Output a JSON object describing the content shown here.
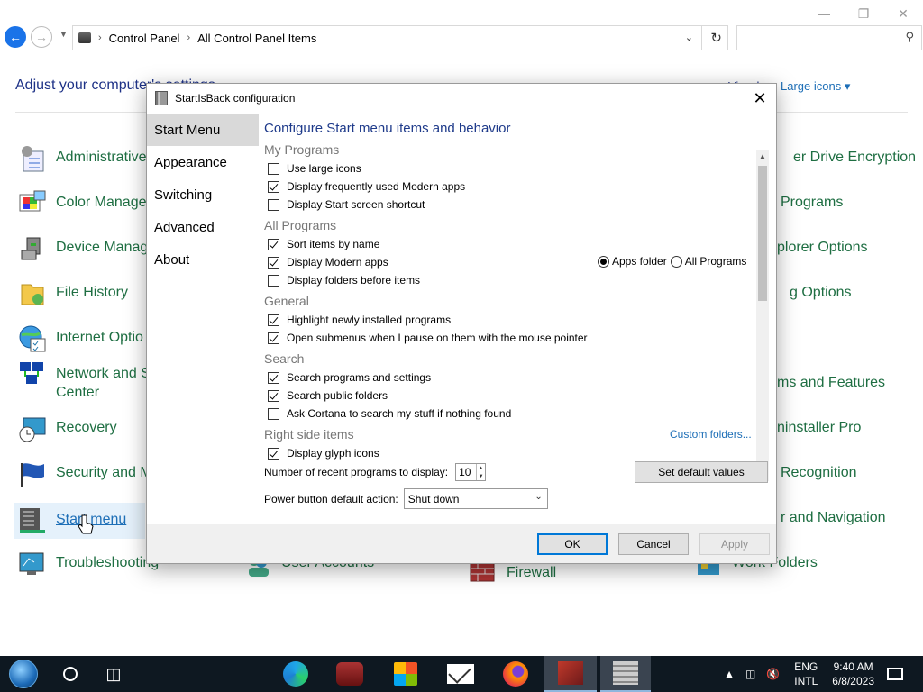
{
  "explorer": {
    "window_controls": [
      "—",
      "❐",
      "✕"
    ],
    "breadcrumb": [
      "Control Panel",
      "All Control Panel Items"
    ],
    "title": "Adjust your computer's settings",
    "view_by_label": "View by:",
    "view_by_value": "Large icons",
    "items": [
      {
        "label": "Administrative Tools",
        "icon": "admin-tools-icon"
      },
      {
        "label": "Color Management",
        "icon": "color-management-icon"
      },
      {
        "label": "Device Manager",
        "icon": "device-manager-icon"
      },
      {
        "label": "File History",
        "icon": "file-history-icon"
      },
      {
        "label": "Internet Options",
        "icon": "internet-options-icon"
      },
      {
        "label": "Network and Sharing Center",
        "icon": "network-icon"
      },
      {
        "label": "Recovery",
        "icon": "recovery-icon"
      },
      {
        "label": "Security and Maintenance",
        "icon": "security-flag-icon"
      },
      {
        "label": "Start menu",
        "icon": "start-menu-icon"
      },
      {
        "label": "Troubleshooting",
        "icon": "troubleshooting-icon"
      },
      {
        "label": "User Accounts",
        "icon": "user-accounts-icon"
      },
      {
        "label": "Windows Defender Firewall",
        "icon": "firewall-icon"
      },
      {
        "label": "Work Folders",
        "icon": "work-folders-icon"
      },
      {
        "label": "BitLocker Drive Encryption",
        "icon": "bitlocker-icon"
      },
      {
        "label": "Default Programs",
        "icon": "default-programs-icon"
      },
      {
        "label": "File Explorer Options",
        "icon": "explorer-options-icon"
      },
      {
        "label": "Indexing Options",
        "icon": "indexing-icon"
      },
      {
        "label": "Programs and Features",
        "icon": "programs-features-icon"
      },
      {
        "label": "Revo Uninstaller Pro",
        "icon": "revo-icon"
      },
      {
        "label": "Speech Recognition",
        "icon": "speech-icon"
      },
      {
        "label": "Taskbar and Navigation",
        "icon": "taskbar-nav-icon"
      }
    ],
    "visible_labels": {
      "admin": "Administrative",
      "color": "Color Manage",
      "device": "Device Manag",
      "filehistory": "File History",
      "internet": "Internet Optio",
      "network_1": "Network and S",
      "network_2": "Center",
      "recovery": "Recovery",
      "security": "Security and M",
      "startmenu": "Start menu",
      "trouble": "Troubleshooting",
      "users": "User Accounts",
      "firewall": "Firewall",
      "work": "Work Folders",
      "bitlocker": "er Drive Encryption",
      "defprog": "Programs",
      "feoptions": "plorer Options",
      "indexing": "g Options",
      "progfeat": "ms and Features",
      "revo": "ninstaller Pro",
      "speech": "Recognition",
      "taskbar": "r and Navigation"
    }
  },
  "dialog": {
    "title": "StartIsBack configuration",
    "nav": [
      "Start Menu",
      "Appearance",
      "Switching",
      "Advanced",
      "About"
    ],
    "active_nav": "Start Menu",
    "heading": "Configure Start menu items and behavior",
    "sections": {
      "my_programs": "My Programs",
      "all_programs": "All Programs",
      "general": "General",
      "search": "Search",
      "right_side": "Right side items"
    },
    "options": {
      "large_icons": {
        "label": "Use large icons",
        "checked": false
      },
      "freq_modern": {
        "label": "Display frequently used Modern apps",
        "checked": true
      },
      "start_screen": {
        "label": "Display Start screen shortcut",
        "checked": false
      },
      "sort_name": {
        "label": "Sort items by name",
        "checked": true
      },
      "modern_apps": {
        "label": "Display Modern apps",
        "checked": true
      },
      "folders_before": {
        "label": "Display folders before items",
        "checked": false
      },
      "highlight_new": {
        "label": "Highlight newly installed programs",
        "checked": true
      },
      "open_submenus": {
        "label": "Open submenus when I pause on them with the mouse pointer",
        "checked": true
      },
      "search_programs": {
        "label": "Search programs and settings",
        "checked": true
      },
      "search_public": {
        "label": "Search public folders",
        "checked": true
      },
      "ask_cortana": {
        "label": "Ask Cortana to search my stuff if nothing found",
        "checked": false
      },
      "glyph_icons": {
        "label": "Display glyph icons",
        "checked": true
      }
    },
    "radio": {
      "apps_folder": "Apps folder",
      "all_programs": "All Programs",
      "selected": "Apps folder"
    },
    "custom_folders": "Custom folders...",
    "recent_label": "Number of recent programs to display:",
    "recent_value": "10",
    "default_button": "Set default values",
    "power_label": "Power button default action:",
    "power_value": "Shut down",
    "buttons": {
      "ok": "OK",
      "cancel": "Cancel",
      "apply": "Apply"
    }
  },
  "taskbar": {
    "lang_1": "ENG",
    "lang_2": "INTL",
    "time": "9:40 AM",
    "date": "6/8/2023"
  }
}
